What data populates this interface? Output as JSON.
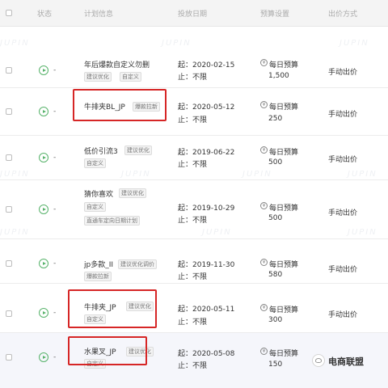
{
  "header": {
    "status": "状态",
    "plan_info": "计划信息",
    "date": "投放日期",
    "budget": "预算设置",
    "bid": "出价方式"
  },
  "rows": [
    {
      "name": "年后爆款自定义勿删",
      "tags": [
        "建议优化",
        "自定义"
      ],
      "start": "起：2020-02-15",
      "end": "止：不限",
      "budget_label": "每日预算",
      "budget_value": "1,500",
      "bid": "手动出价",
      "status": "-"
    },
    {
      "name": "牛排夹BL_JP",
      "tags": [
        "爆款拉新"
      ],
      "start": "起：2020-05-12",
      "end": "止：不限",
      "budget_label": "每日预算",
      "budget_value": "250",
      "bid": "手动出价",
      "status": "-"
    },
    {
      "name": "低价引流3",
      "tags": [
        "建议优化",
        "自定义"
      ],
      "start": "起：2019-06-22",
      "end": "止：不限",
      "budget_label": "每日预算",
      "budget_value": "500",
      "bid": "手动出价",
      "status": "-"
    },
    {
      "name": "猜你喜欢",
      "tags": [
        "建议优化",
        "自定义",
        "直通车定向日期计划"
      ],
      "start": "起：2019-10-29",
      "end": "止：不限",
      "budget_label": "每日预算",
      "budget_value": "500",
      "bid": "手动出价",
      "status": "-"
    },
    {
      "name": "jp多款_II",
      "tags": [
        "建议优化调价",
        "爆款拉新"
      ],
      "start": "起：2019-11-30",
      "end": "止：不限",
      "budget_label": "每日预算",
      "budget_value": "580",
      "bid": "手动出价",
      "status": "-"
    },
    {
      "name": "牛排夹_JP",
      "tags": [
        "建议优化",
        "自定义"
      ],
      "start": "起：2020-05-11",
      "end": "止：不限",
      "budget_label": "每日预算",
      "budget_value": "300",
      "bid": "手动出价",
      "status": "-"
    },
    {
      "name": "水果叉_JP",
      "tags": [
        "建议优化",
        "自定义"
      ],
      "start": "起：2020-05-08",
      "end": "止：不限",
      "budget_label": "每日预算",
      "budget_value": "150",
      "bid": "",
      "status": "-"
    }
  ],
  "watermark": "JUPIN",
  "logo_text": "电商联盟",
  "colors": {
    "highlight": "#d62626",
    "status_green": "#58b36b"
  }
}
